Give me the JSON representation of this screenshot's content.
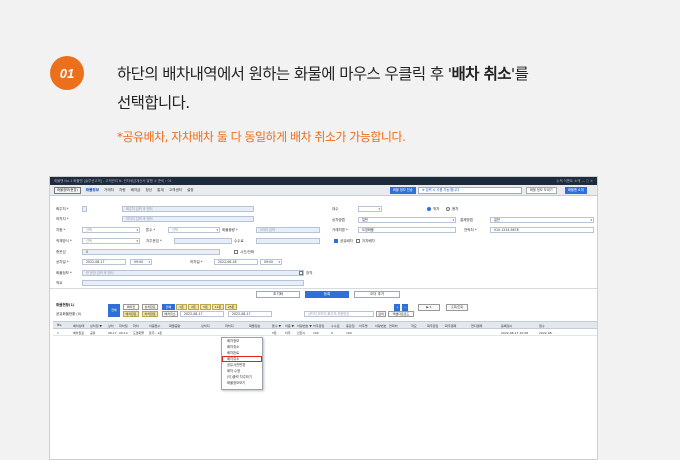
{
  "step": {
    "number": "01"
  },
  "instruction": {
    "line1_before": "하단의 배차내역에서 원하는 화물에 마우스 우클릭 후 '",
    "line1_bold": "배차 취소",
    "line1_after": "'를",
    "line2": "선택합니다."
  },
  "note": "*공유배차, 자차배차 둘 다 동일하게 배차 취소가 가능합니다.",
  "app": {
    "titlebar": "화물맨 No.1 화물맨 [솔루션고객] - 고객관리 N. 전자세금계산서 발행 ① 준비 : 01",
    "titlebar_right": "누적 이벤트 소개 — ▢ ✕",
    "menu_first": "화물정보(현장)",
    "menu": [
      "화물정보",
      "거래처",
      "차량",
      "배차금",
      "정산",
      "통계",
      "고객센터",
      "설정"
    ],
    "top_right_buttons": [
      "화물 정보 전송",
      "※ 입력 시 사용 가능 합니다",
      "화물 정보 보내기",
      "화물맨 소개"
    ],
    "form": {
      "lbl_shipper": "화주처 *",
      "val_shipper": "화주처 입력 후 엔터",
      "lbl_receiver": "하차지 *",
      "val_receiver": "하차지 입력 후 엔터",
      "lbl_car": "차종 *",
      "val_car": "선택",
      "lbl_ton": "톤수 *",
      "val_ton": "선택",
      "lbl_cargo": "화물중량 *",
      "val_cargo": "5자리 입력",
      "lbl_loadtype": "적재방식 *",
      "val_loadtype": "선택",
      "lbl_cargoname": "차주운임 *",
      "lbl_fee": "수수료",
      "lbl_total": "총운임",
      "val_total": "0",
      "lbl_time": "시간/전화",
      "lbl_loaddate": "상차일 *",
      "val_loaddate": "2022-08-17",
      "val_loadtime": "09:00",
      "lbl_unloaddate": "하차일 *",
      "val_unloaddate": "2022-08-18",
      "val_unloadtime": "09:00",
      "lbl_info": "화물정보 *",
      "val_info": "한 문장 입력 후 엔터",
      "lbl_memo": "적요",
      "lbl_type": "상차방법",
      "val_type": "일반",
      "lbl_pay": "결제방법",
      "val_pay": "일반",
      "lbl_method": "지불방법",
      "val_method": "일반",
      "lbl_client": "거래처명 *",
      "val_client": "도영화물",
      "lbl_phone": "연락처 *",
      "val_phone": "010-1234-5678",
      "lbl_share": "공유배차",
      "lbl_own": "자차배차",
      "lbl_dispatch": "배차",
      "radio1": "퀵차",
      "radio2": "용차",
      "lbl_mark": "장착",
      "lbl_cnt": "대수"
    },
    "actions": {
      "reset": "초기화",
      "register": "등록",
      "shareadd": "오더 추가"
    },
    "list": {
      "title": "화물현황(1)",
      "subtitle": "공유화물현황 (0)",
      "all_button": "전체",
      "filters": [
        "배차전",
        "배차완료",
        "상차완료",
        "하차완료",
        "배차취소"
      ],
      "tabs": [
        "전체",
        "1톤",
        "2톤",
        "5톤",
        "11톤",
        "25톤"
      ],
      "date_from": "2022-08-17",
      "date_to": "2022-08-17",
      "search_placeholder": "상차지,하차지,화주처,차량번호",
      "search_btn": "검색",
      "excel": "엑셀다운로드",
      "page": "1",
      "print": "출력/조회"
    },
    "columns": [
      "No.",
      "배차상태",
      "상차일 ▼",
      "상차",
      "하차일",
      "하차",
      "차종톤수",
      "화물중량",
      "상차지",
      "하차지",
      "화물정보",
      "톤수 ▼",
      "차종 ▼",
      "차량번호 ▼",
      "차주운임",
      "수수료",
      "총운임",
      "차주명",
      "차량번호",
      "연락처",
      "적요",
      "화주운임",
      "화주결제",
      "현지결제",
      "등록일시",
      "접수"
    ],
    "row": [
      "1",
      "배차완료",
      "공유",
      "08-17",
      "09:14",
      "도영화물",
      "톤주 : 1톤",
      "",
      "",
      "",
      "",
      "5톤",
      "차주",
      "인천시",
      "100",
      "0",
      "100",
      "",
      "",
      "",
      "",
      "",
      "",
      "",
      "2022-08-17 10:08",
      "2022-08-"
    ],
    "context_menu": [
      "배차정보",
      "배차취소",
      "배차완료",
      "배차취소",
      "공유사관변경",
      "배차 수정",
      "(이)출력 차주하기",
      "화물정보보기"
    ],
    "context_highlight_index": 3
  }
}
